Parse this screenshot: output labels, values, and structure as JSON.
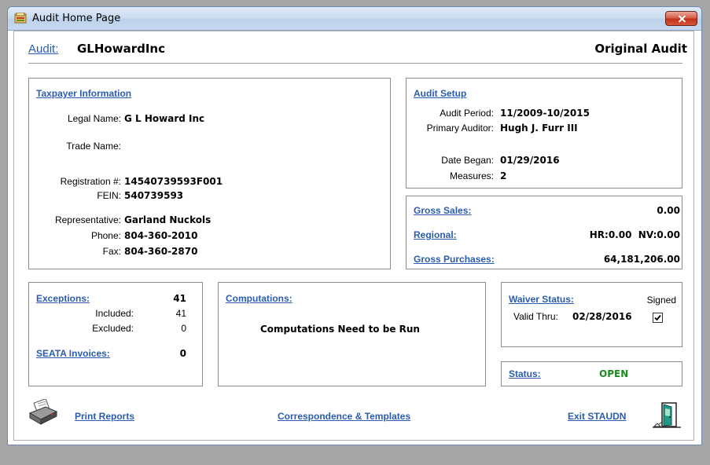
{
  "window": {
    "title": "Audit Home Page"
  },
  "header": {
    "audit_link": "Audit:",
    "audit_name": "GLHowardInc",
    "audit_type": "Original Audit"
  },
  "taxpayer": {
    "heading": "Taxpayer Information",
    "legal_name_label": "Legal Name:",
    "legal_name": "G L Howard Inc",
    "trade_name_label": "Trade Name:",
    "trade_name": "",
    "registration_label": "Registration #:",
    "registration": "14540739593F001",
    "fein_label": "FEIN:",
    "fein": "540739593",
    "rep_label": "Representative:",
    "rep": "Garland Nuckols",
    "phone_label": "Phone:",
    "phone": "804-360-2010",
    "fax_label": "Fax:",
    "fax": "804-360-2870"
  },
  "setup": {
    "heading": "Audit Setup",
    "period_label": "Audit Period:",
    "period": "11/2009-10/2015",
    "auditor_label": "Primary Auditor:",
    "auditor": "Hugh J. Furr III",
    "began_label": "Date Began:",
    "began": "01/29/2016",
    "measures_label": "Measures:",
    "measures": "2"
  },
  "totals": {
    "gross_sales_label": "Gross Sales:",
    "gross_sales": "0.00",
    "regional_label": "Regional:",
    "regional": "HR:0.00  NV:0.00",
    "gross_purchases_label": "Gross Purchases:",
    "gross_purchases": "64,181,206.00"
  },
  "exceptions": {
    "label": "Exceptions:",
    "total": "41",
    "included_label": "Included:",
    "included": "41",
    "excluded_label": "Excluded:",
    "excluded": "0",
    "seata_label": "SEATA Invoices:",
    "seata": "0"
  },
  "computations": {
    "label": "Computations:",
    "message": "Computations Need to be Run"
  },
  "waiver": {
    "label": "Waiver Status:",
    "status": "Signed",
    "valid_label": "Valid Thru:",
    "valid_date": "02/28/2016",
    "checked": true
  },
  "status": {
    "label": "Status:",
    "value": "OPEN",
    "color": "#1a8a1a"
  },
  "footer": {
    "print": "Print Reports",
    "correspondence": "Correspondence & Templates",
    "exit": "Exit STAUDN"
  }
}
